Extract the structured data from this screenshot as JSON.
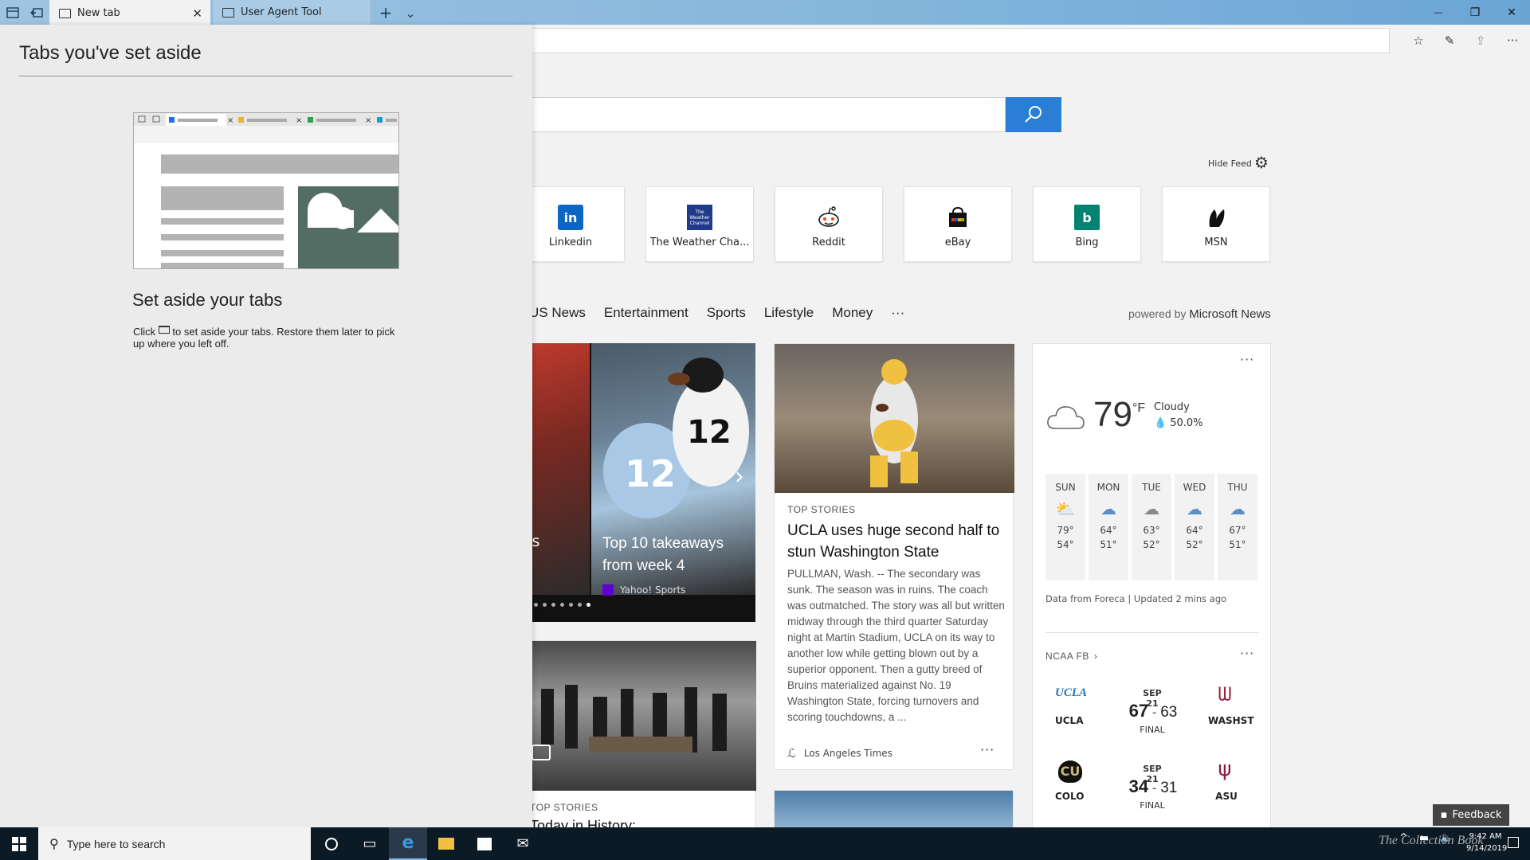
{
  "tabs": [
    {
      "label": "New tab",
      "close": "✕"
    },
    {
      "label": "User Agent Tool"
    }
  ],
  "titlebar": {
    "new_tab_glyph": "+",
    "tab_list_glyph": "⌄",
    "minimize": "—",
    "restore": "❐",
    "close": "✕"
  },
  "toolbar": {
    "favorites_icon": "☆",
    "pen_icon": "✎",
    "share_icon": "⇪",
    "more_icon": "···"
  },
  "page": {
    "hide_feed": "Hide Feed",
    "tiles": [
      {
        "label": "Linkedin",
        "logo": "in",
        "color": "#0a66c2"
      },
      {
        "label": "The Weather Cha...",
        "logo": "The Weather Channel",
        "color": "#1f3a8a"
      },
      {
        "label": "Reddit",
        "logo": "reddit-icon",
        "color": "#ffffff"
      },
      {
        "label": "eBay",
        "logo": "ebay-icon",
        "color": "#ffffff"
      },
      {
        "label": "Bing",
        "logo": "b",
        "color": "#008373"
      },
      {
        "label": "MSN",
        "logo": "msn-icon",
        "color": "#ffffff"
      }
    ],
    "nav": [
      "US News",
      "Entertainment",
      "Sports",
      "Lifestyle",
      "Money",
      "···"
    ],
    "powered_prefix": "powered by",
    "powered_brand": "Microsoft News",
    "carousel": {
      "left_caption": "ers",
      "title": "Top 10 takeaways from week 4",
      "source": "Yahoo! Sports",
      "next_glyph": "›"
    },
    "history_card": {
      "tag": "TOP STORIES",
      "title": "Today in History:"
    },
    "story": {
      "tag": "TOP STORIES",
      "title": "UCLA uses huge second half to stun Washington State",
      "body": "PULLMAN, Wash. -- The secondary was sunk. The season was in ruins. The coach was outmatched. The story was all but written midway through the third quarter Saturday night at Martin Stadium, UCLA on its way to another low while getting blown out by a superior opponent. Then a gutty breed of Bruins materialized against No. 19 Washington State, forcing turnovers and scoring touchdowns, a ...",
      "source": "Los Angeles Times",
      "more": "···"
    },
    "weather": {
      "more": "···",
      "temp": "79",
      "unit": "°F",
      "condition": "Cloudy",
      "precip": "50.0%",
      "forecast": [
        {
          "day": "SUN",
          "hi": "79°",
          "lo": "54°"
        },
        {
          "day": "MON",
          "hi": "64°",
          "lo": "51°"
        },
        {
          "day": "TUE",
          "hi": "63°",
          "lo": "52°"
        },
        {
          "day": "WED",
          "hi": "64°",
          "lo": "52°"
        },
        {
          "day": "THU",
          "hi": "67°",
          "lo": "51°"
        }
      ],
      "source": "Data from Foreca | Updated 2 mins ago"
    },
    "ncaa": {
      "title": "NCAA FB",
      "chevron": "›",
      "more": "···",
      "games": [
        {
          "date": "SEP 21",
          "home": "UCLA",
          "home_score": "67",
          "away_score": "63",
          "away": "WASHST",
          "status": "FINAL"
        },
        {
          "date": "SEP 21",
          "home": "COLO",
          "home_score": "34",
          "away_score": "31",
          "away": "ASU",
          "status": "FINAL"
        }
      ]
    },
    "feedback": "Feedback"
  },
  "panel": {
    "title": "Tabs you've set aside",
    "heading": "Set aside your tabs",
    "body_before": "Click",
    "body_after": "to set aside your tabs. Restore them later to pick up where you left off."
  },
  "taskbar": {
    "search_placeholder": "Type here to search",
    "time": "9:42 AM",
    "date": "9/14/2019",
    "watermark": "The Collection Book"
  }
}
